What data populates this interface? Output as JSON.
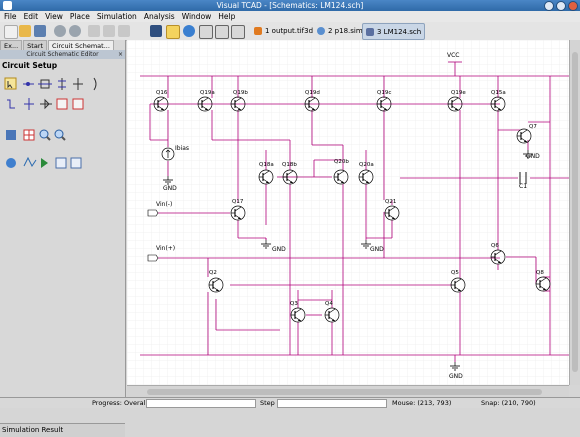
{
  "window": {
    "title": "Visual TCAD - [Schematics: LM124.sch]"
  },
  "menu": [
    "File",
    "Edit",
    "View",
    "Place",
    "Simulation",
    "Analysis",
    "Window",
    "Help"
  ],
  "doc_tabs": [
    {
      "label": "1 output.tif3d",
      "active": false
    },
    {
      "label": "2 p18.sim",
      "active": false
    },
    {
      "label": "3 LM124.sch",
      "active": true
    }
  ],
  "left_panel": {
    "tabs": [
      "Ex...",
      "Start",
      "Circuit Schemat..."
    ],
    "subtitle": "Circuit Schematic Editor",
    "heading": "Circuit Setup",
    "bottom_label": "Simulation Result"
  },
  "schematic": {
    "labels": {
      "vcc": "VCC",
      "gnd": "GND",
      "ibias": "Ibias",
      "vin_minus": "Vin(-)",
      "vin_plus": "Vin(+)",
      "c1": "C1"
    },
    "transistors": [
      "Q16",
      "Q19a",
      "Q19b",
      "Q19d",
      "Q19c",
      "Q19e",
      "Q15a",
      "Q7",
      "Q18a",
      "Q18b",
      "Q20b",
      "Q20a",
      "Q17",
      "Q21",
      "Q2",
      "Q3",
      "Q4",
      "Q5",
      "Q6",
      "Q8"
    ]
  },
  "status": {
    "progress_label": "Progress: Overall",
    "step_label": "Step",
    "mouse": "Mouse: (213, 793)",
    "snap": "Snap: (210, 790)"
  },
  "colors": {
    "wire": "#b0007a",
    "title_bar": "#3d78b8",
    "grid": "#e6e6e6"
  }
}
